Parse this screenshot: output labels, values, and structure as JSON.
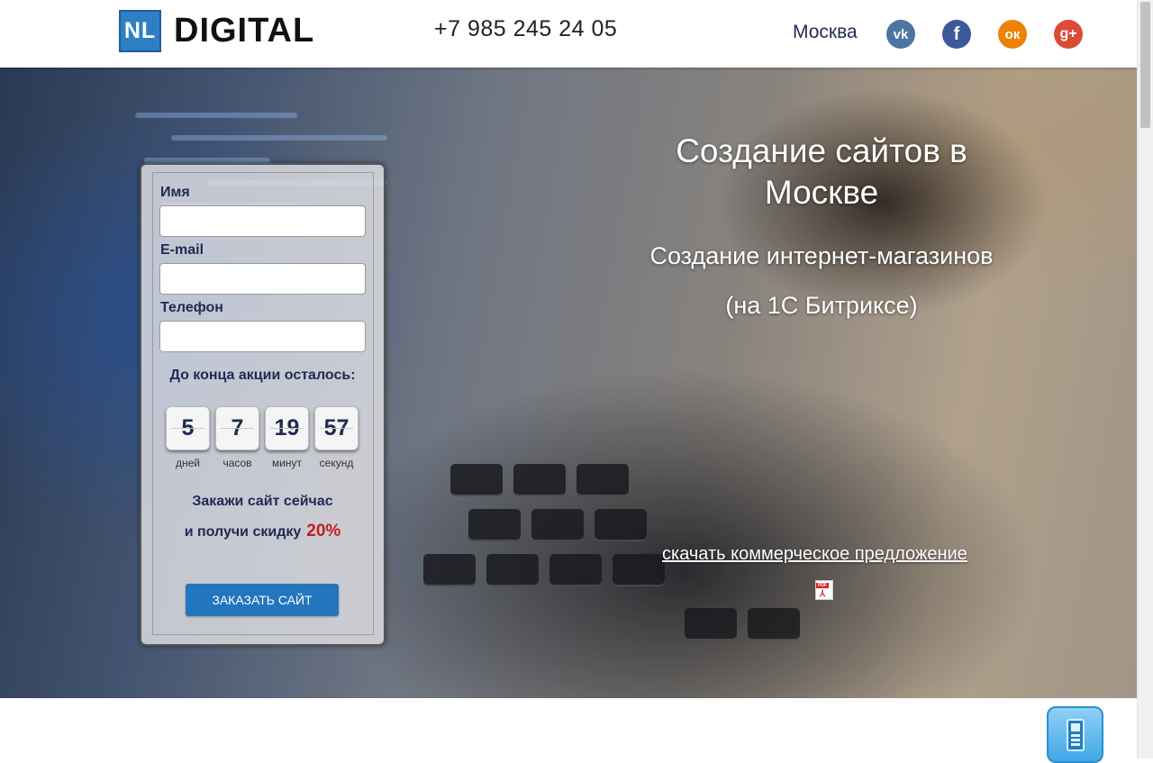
{
  "header": {
    "logo_badge": "NL",
    "logo_text": "DIGITAL",
    "phone": "+7 985 245 24 05",
    "city": "Москва",
    "social": [
      {
        "name": "vk-icon",
        "glyph": "vk",
        "color": "#4c75a3"
      },
      {
        "name": "facebook-icon",
        "glyph": "f",
        "color": "#3b5998"
      },
      {
        "name": "odnoklassniki-icon",
        "glyph": "ок",
        "color": "#ee8208"
      },
      {
        "name": "google-plus-icon",
        "glyph": "g+",
        "color": "#dc4a38"
      }
    ]
  },
  "hero": {
    "title": "Создание сайтов в Москве",
    "subtitle1": "Создание интернет-магазинов",
    "subtitle2": "(на 1С Битриксе)",
    "offer_link": "скачать коммерческое предложение",
    "offer_icon": "pdf-icon"
  },
  "form": {
    "name_label": "Имя",
    "name_value": "",
    "email_label": "E-mail",
    "email_value": "",
    "phone_label": "Телефон",
    "phone_value": "",
    "countdown_title": "До конца акции осталось:",
    "countdown": [
      {
        "value": "5",
        "unit": "дней"
      },
      {
        "value": "7",
        "unit": "часов"
      },
      {
        "value": "19",
        "unit": "минут"
      },
      {
        "value": "57",
        "unit": "секунд"
      }
    ],
    "promo_line1": "Закажи сайт сейчас",
    "promo_line2": "и получи скидку",
    "promo_discount": "20%",
    "submit_label": "ЗАКАЗАТЬ САЙТ"
  },
  "callback_icon": "mobile-phone-icon",
  "colors": {
    "accent": "#2375bd",
    "discount": "#c41d1d",
    "text_dark": "#1f2a52"
  }
}
